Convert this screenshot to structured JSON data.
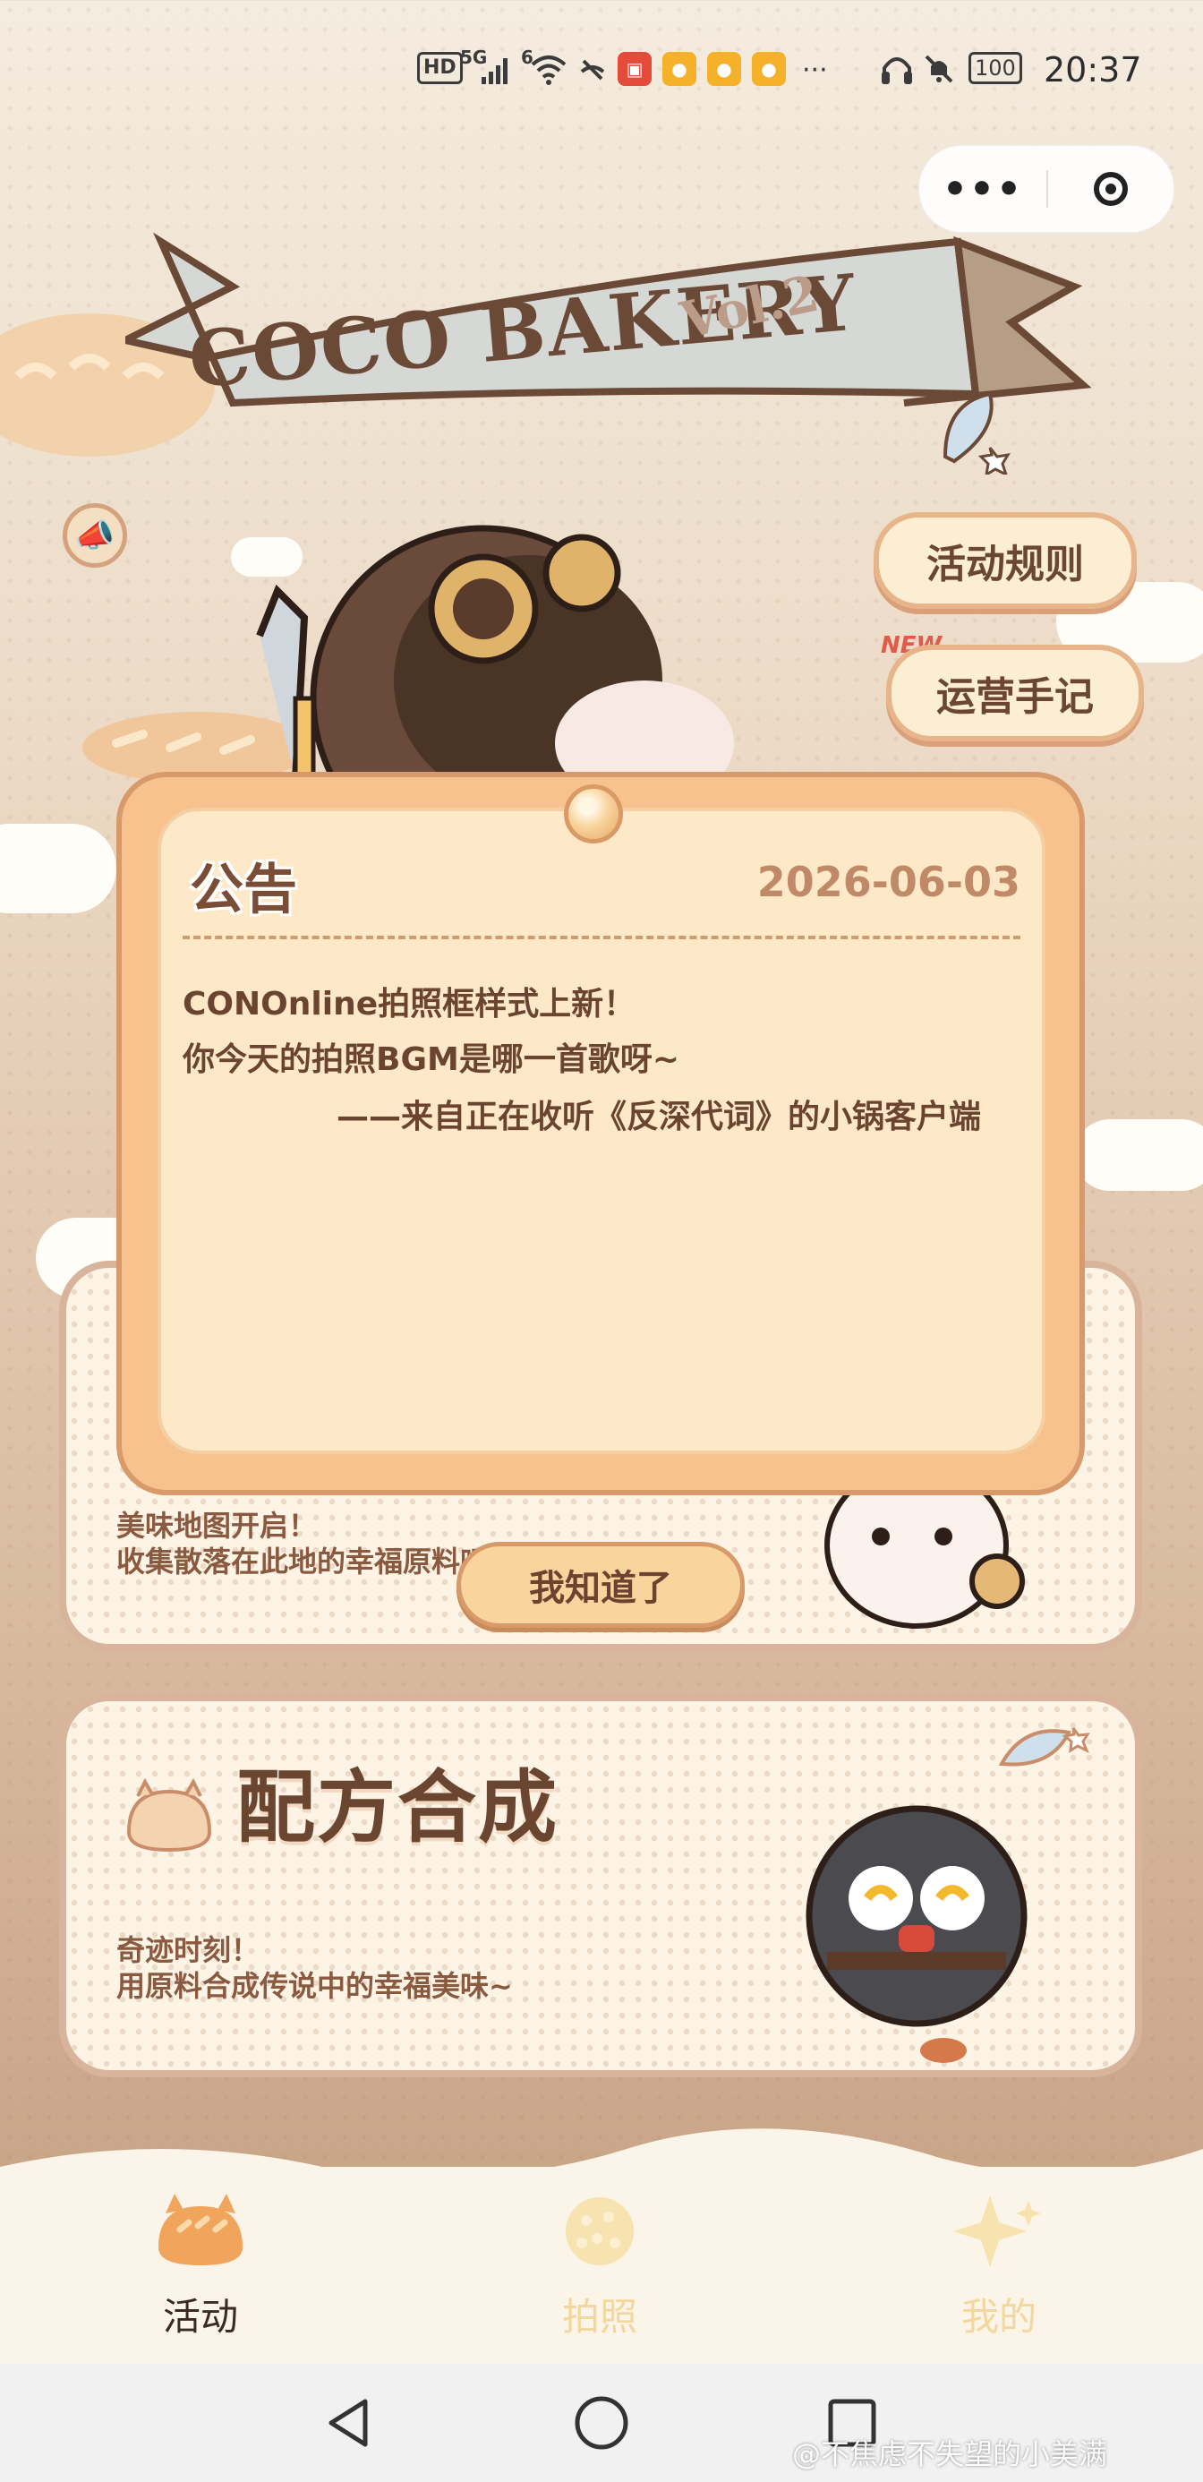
{
  "status_bar": {
    "hd": "HD",
    "net_5g": "5G",
    "net_6": "6",
    "more": "···",
    "battery": "100",
    "time": "20:37",
    "icons": [
      "signal-icon",
      "wifi-icon",
      "huawei-app-icon",
      "weibo-app-icon",
      "weibo-app-icon",
      "weibo-app-icon",
      "headphones-icon",
      "mute-bell-icon",
      "battery-icon"
    ]
  },
  "capsule": {
    "more": "•••"
  },
  "banner": {
    "title": "COCO BAKERY",
    "vol": "Vol.2"
  },
  "side_buttons": {
    "rules": "活动规则",
    "new_badge": "NEW",
    "notes": "运营手记"
  },
  "cards": {
    "map": {
      "line1": "美味地图开启！",
      "line2": "收集散落在此地的幸福原料吧！"
    },
    "recipe": {
      "title": "配方合成",
      "line1": "奇迹时刻！",
      "line2": "用原料合成传说中的幸福美味~"
    }
  },
  "modal": {
    "title": "公告",
    "date": "2026-06-03",
    "lines": [
      "CONOnline拍照框样式上新！",
      "你今天的拍照BGM是哪一首歌呀~",
      "——来自正在收听《反深代词》的小锅客户端"
    ],
    "ok_button": "我知道了"
  },
  "tabs": [
    {
      "label": "活动",
      "active": true
    },
    {
      "label": "拍照",
      "active": false
    },
    {
      "label": "我的",
      "active": false
    }
  ],
  "watermark": "@不焦虑不失望的小美满",
  "colors": {
    "tab_active": "#3a2a22",
    "tab_inactive": "#f3d79c",
    "accent": "#f7c28e",
    "text_brown": "#6b4430"
  }
}
